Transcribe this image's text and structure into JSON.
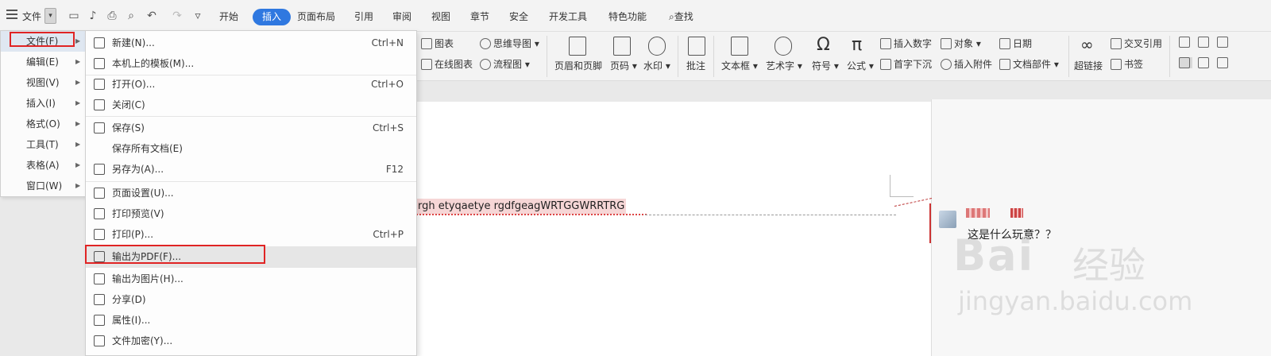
{
  "menubar": {
    "file_label": "文件",
    "tabs": [
      "开始",
      "插入",
      "页面布局",
      "引用",
      "审阅",
      "视图",
      "章节",
      "安全",
      "开发工具",
      "特色功能"
    ],
    "active_tab": "插入",
    "search_label": "查找"
  },
  "ribbon": {
    "items": {
      "chart": "图表",
      "mindmap": "思维导图",
      "online_chart": "在线图表",
      "flowchart": "流程图",
      "header_footer": "页眉和页脚",
      "page_number": "页码",
      "watermark": "水印",
      "comment": "批注",
      "textbox": "文本框",
      "wordart": "艺术字",
      "symbol": "符号",
      "formula": "公式",
      "insert_number": "插入数字",
      "object": "对象",
      "date": "日期",
      "drop_cap": "首字下沉",
      "attachment": "插入附件",
      "doc_parts": "文档部件",
      "hyperlink": "超链接",
      "cross_ref": "交叉引用",
      "bookmark": "书签"
    }
  },
  "leftmenu": {
    "items": [
      {
        "label": "文件(F)"
      },
      {
        "label": "编辑(E)"
      },
      {
        "label": "视图(V)"
      },
      {
        "label": "插入(I)"
      },
      {
        "label": "格式(O)"
      },
      {
        "label": "工具(T)"
      },
      {
        "label": "表格(A)"
      },
      {
        "label": "窗口(W)"
      }
    ]
  },
  "filemenu": {
    "items": [
      {
        "label": "新建(N)...",
        "shortcut": "Ctrl+N"
      },
      {
        "label": "本机上的模板(M)...",
        "shortcut": ""
      },
      {
        "label": "打开(O)...",
        "shortcut": "Ctrl+O"
      },
      {
        "label": "关闭(C)",
        "shortcut": ""
      },
      {
        "label": "保存(S)",
        "shortcut": "Ctrl+S"
      },
      {
        "label": "保存所有文档(E)",
        "shortcut": ""
      },
      {
        "label": "另存为(A)...",
        "shortcut": "F12"
      },
      {
        "label": "页面设置(U)...",
        "shortcut": ""
      },
      {
        "label": "打印预览(V)",
        "shortcut": ""
      },
      {
        "label": "打印(P)...",
        "shortcut": "Ctrl+P"
      },
      {
        "label": "输出为PDF(F)...",
        "shortcut": ""
      },
      {
        "label": "输出为图片(H)...",
        "shortcut": ""
      },
      {
        "label": "分享(D)",
        "shortcut": ""
      },
      {
        "label": "属性(I)...",
        "shortcut": ""
      },
      {
        "label": "文件加密(Y)...",
        "shortcut": ""
      }
    ]
  },
  "document": {
    "text": "rgh etyqaetye rgdfgeagWRTGGWRRTRG"
  },
  "comment": {
    "text": "这是什么玩意？？"
  },
  "watermark": {
    "brand": "Bai",
    "brand2": "经验",
    "url": "jingyan.baidu.com"
  },
  "colors": {
    "accent": "#2f78e0",
    "highlight_box": "#e02424",
    "selected_text_bg": "#f6d6d6"
  }
}
